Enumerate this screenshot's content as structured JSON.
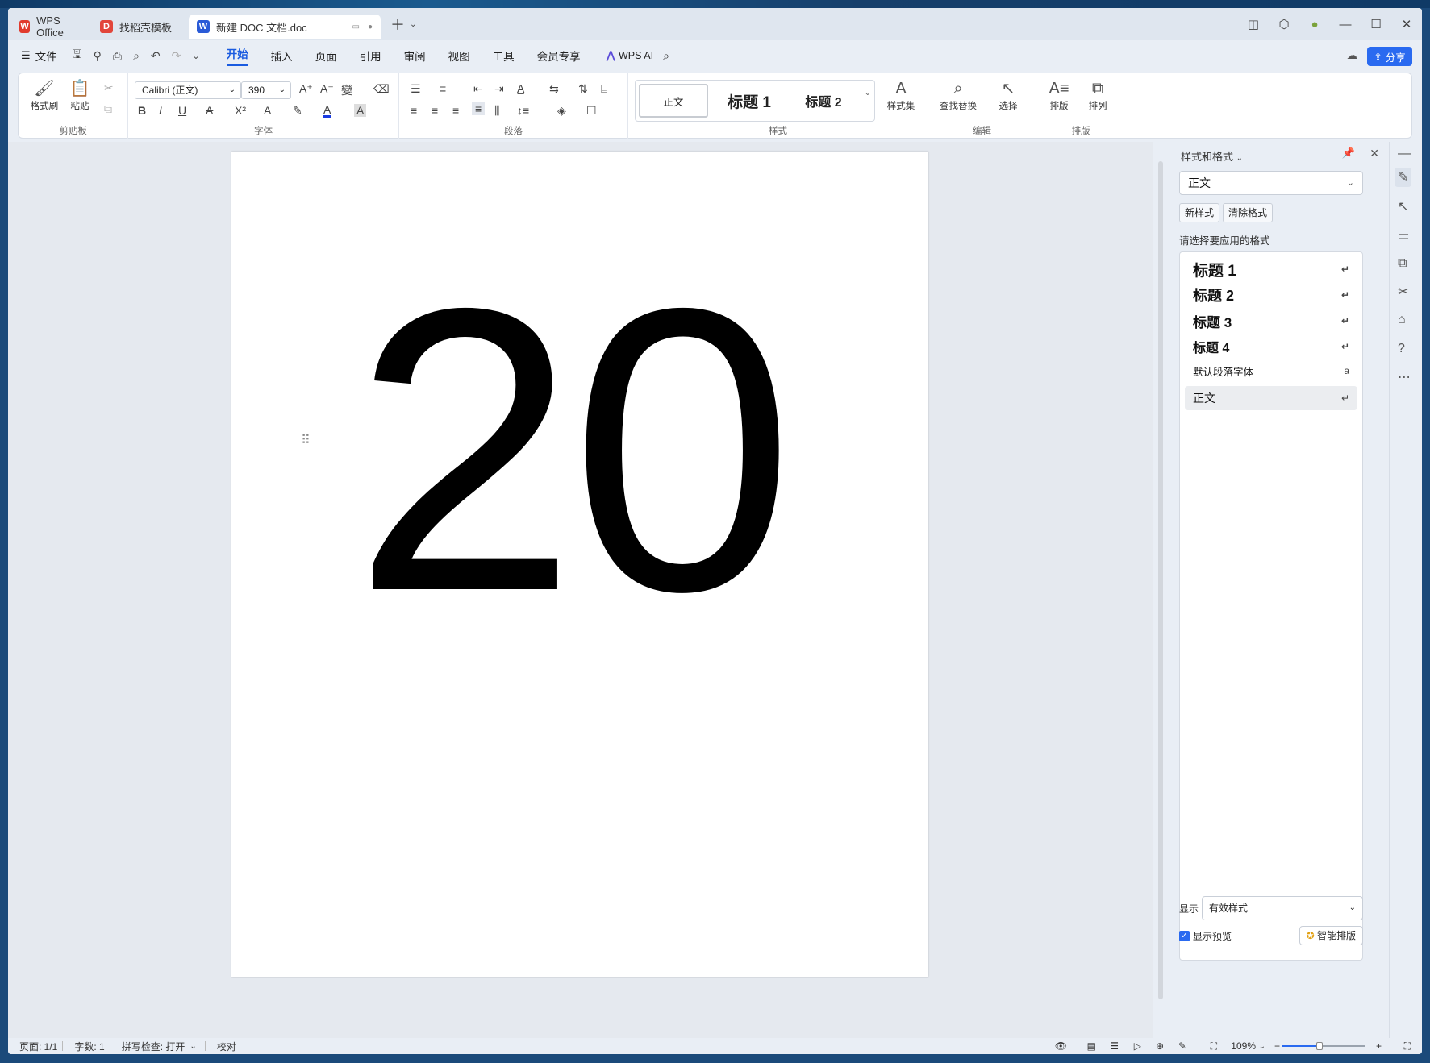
{
  "titlebar": {
    "tabs": [
      {
        "label": "WPS Office",
        "icon": "wps-icon",
        "color": "#e13b2d"
      },
      {
        "label": "找稻壳模板",
        "icon": "docer-icon",
        "color": "#e2463b"
      },
      {
        "label": "新建 DOC 文档.doc",
        "icon": "word-icon",
        "color": "#2a5bd7"
      }
    ]
  },
  "menubar": {
    "file": "文件",
    "items": [
      "开始",
      "插入",
      "页面",
      "引用",
      "审阅",
      "视图",
      "工具",
      "会员专享"
    ],
    "active": "开始",
    "ai": "WPS AI",
    "share": "分享"
  },
  "ribbon": {
    "clipboard": {
      "label": "剪贴板",
      "format_painter": "格式刷",
      "paste": "粘贴"
    },
    "font": {
      "label": "字体",
      "name": "Calibri (正文)",
      "size": "390"
    },
    "paragraph": {
      "label": "段落"
    },
    "styles": {
      "label": "样式",
      "normal": "正文",
      "h1": "标题 1",
      "h2": "标题 2",
      "style_set": "样式集"
    },
    "edit": {
      "label": "编辑",
      "find_replace": "查找替换",
      "select": "选择"
    },
    "layout": {
      "label": "排版",
      "typeset": "排版",
      "arrange": "排列"
    }
  },
  "document": {
    "content": "20"
  },
  "pane": {
    "title": "样式和格式",
    "current_style": "正文",
    "new_style": "新样式",
    "clear_format": "清除格式",
    "hint": "请选择要应用的格式",
    "styles": [
      {
        "label": "标题 1",
        "mark": "↵"
      },
      {
        "label": "标题 2",
        "mark": "↵"
      },
      {
        "label": "标题 3",
        "mark": "↵"
      },
      {
        "label": "标题 4",
        "mark": "↵"
      },
      {
        "label": "默认段落字体",
        "mark": "a"
      },
      {
        "label": "正文",
        "mark": "↵"
      }
    ],
    "show_label": "显示",
    "show_value": "有效样式",
    "preview_label": "显示预览",
    "smart_layout": "智能排版"
  },
  "status": {
    "page": "页面: 1/1",
    "words": "字数: 1",
    "spell": "拼写检查: 打开",
    "proof": "校对",
    "zoom": "109%",
    "zoom_fraction": 0.45
  }
}
